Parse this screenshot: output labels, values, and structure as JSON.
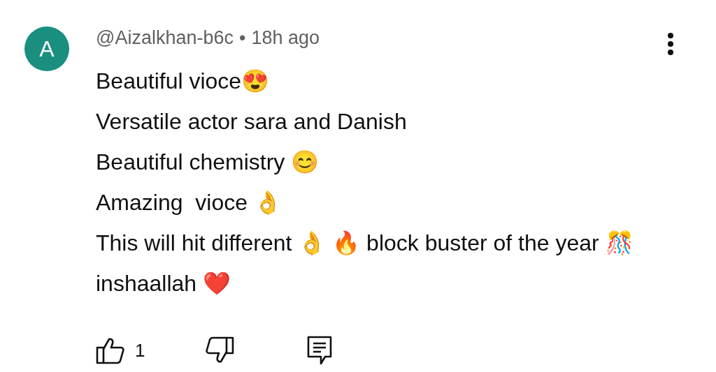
{
  "comment": {
    "avatar_letter": "A",
    "author": "@Aizalkhan-b6c",
    "separator": "•",
    "time": "18h ago",
    "text": "Beautiful vioce😍\nVersatile actor sara and Danish\nBeautiful chemistry 😊\nAmazing  vioce 👌\nThis will hit different 👌 🔥 block buster of the year 🎊 inshaallah ❤️",
    "like_count": "1"
  }
}
